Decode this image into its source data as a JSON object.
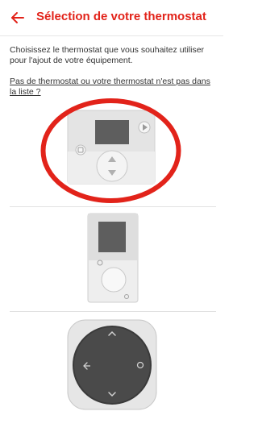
{
  "header": {
    "title": "Sélection de votre thermostat",
    "back_icon": "arrow-left-icon",
    "accent_color": "#e2231a"
  },
  "intro": {
    "text": "Choisissez le thermostat que vous souhaitez utiliser pour l'ajout de votre équipement."
  },
  "links": {
    "no_thermostat": "Pas de thermostat ou votre thermostat n'est pas dans la liste ?"
  },
  "thermostats": [
    {
      "icon": "square-thermostat-icon",
      "selected": true
    },
    {
      "icon": "vertical-thermostat-icon",
      "selected": false
    },
    {
      "icon": "round-dial-thermostat-icon",
      "selected": false
    }
  ]
}
